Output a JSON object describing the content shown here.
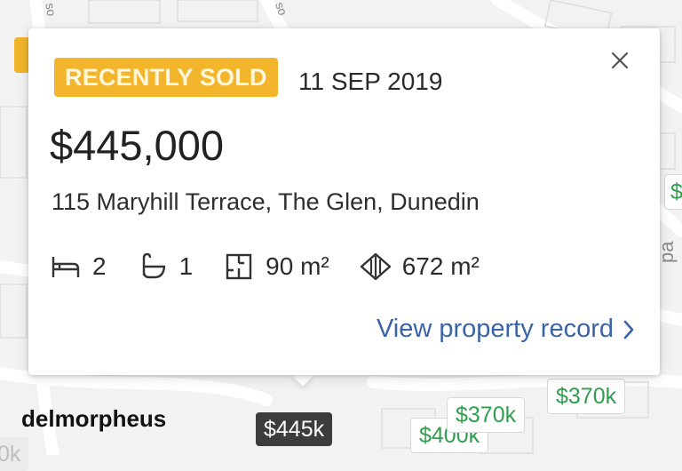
{
  "map": {
    "street_labels": [
      "so",
      "so",
      "pa"
    ],
    "user_label": "delmorpheus",
    "pins": {
      "selected": "$445k",
      "p370a": "$370k",
      "p370b": "$370k",
      "p400": "$400k",
      "right_partial": "$",
      "left_partial": "0k"
    }
  },
  "popup": {
    "badge": "RECENTLY SOLD",
    "sold_date": "11 SEP 2019",
    "price": "$445,000",
    "address": "115 Maryhill Terrace, The Glen, Dunedin",
    "features": {
      "bedrooms": "2",
      "bathrooms": "1",
      "floor_area": "90 m²",
      "land_area": "672 m²"
    },
    "view_link": "View property record",
    "close_icon": "close-icon"
  },
  "colors": {
    "badge_bg": "#f2b52c",
    "link": "#3a64a6",
    "pin_green_text": "#2f9e4e",
    "pin_selected_bg": "#3c3c3c"
  }
}
